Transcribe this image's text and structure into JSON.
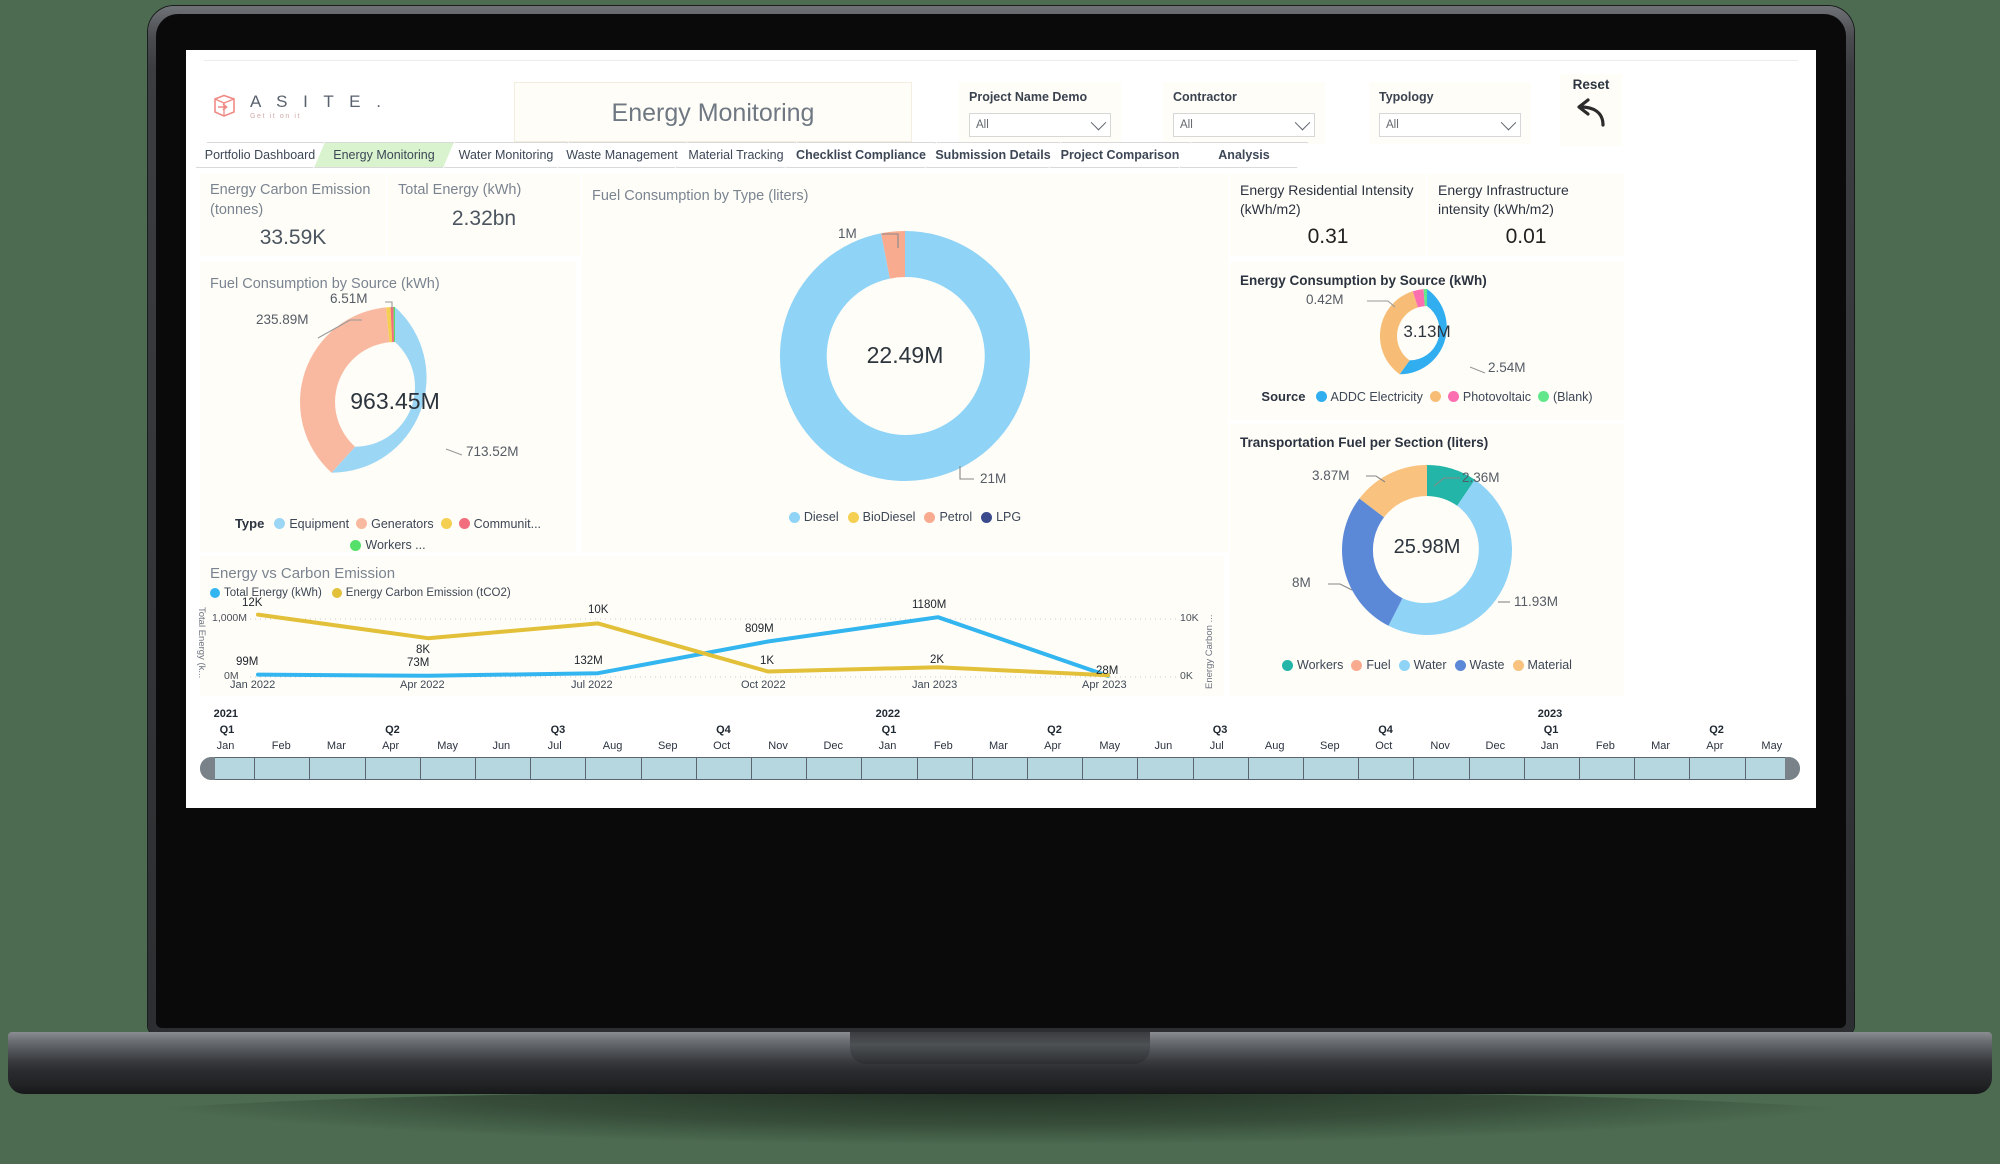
{
  "brand": {
    "name": "A S I T E .",
    "tagline": "Get it on it"
  },
  "header": {
    "title": "Energy Monitoring",
    "reset_label": "Reset",
    "filters": [
      {
        "label": "Project Name Demo",
        "value": "All"
      },
      {
        "label": "Contractor",
        "value": "All"
      },
      {
        "label": "Typology",
        "value": "All"
      }
    ]
  },
  "tabs": [
    {
      "label": "Portfolio Dashboard",
      "active": false,
      "bold": false
    },
    {
      "label": "Energy Monitoring",
      "active": true,
      "bold": false
    },
    {
      "label": "Water Monitoring",
      "active": false,
      "bold": false
    },
    {
      "label": "Waste Management",
      "active": false,
      "bold": false
    },
    {
      "label": "Material Tracking",
      "active": false,
      "bold": false
    },
    {
      "label": "Checklist Compliance",
      "active": false,
      "bold": true
    },
    {
      "label": "Submission Details",
      "active": false,
      "bold": true
    },
    {
      "label": "Project Comparison",
      "active": false,
      "bold": true
    },
    {
      "label": "Analysis",
      "active": false,
      "bold": true
    }
  ],
  "kpis": [
    {
      "title": "Energy Carbon Emission (tonnes)",
      "value": "33.59K"
    },
    {
      "title": "Total Energy (kWh)",
      "value": "2.32bn"
    },
    {
      "title": "Energy Residential Intensity (kWh/m2)",
      "value": "0.31"
    },
    {
      "title": "Energy Infrastructure intensity (kWh/m2)",
      "value": "0.01"
    }
  ],
  "chart_data": [
    {
      "id": "fuel_by_type",
      "type": "pie",
      "title": "Fuel Consumption by Type (liters)",
      "center_label": "22.49M",
      "legend_position": "bottom",
      "categories": [
        "Diesel",
        "BioDiesel",
        "Petrol",
        "LPG"
      ],
      "values": [
        21,
        0,
        1,
        0
      ],
      "value_labels": [
        "21M",
        "",
        "1M",
        ""
      ],
      "colors": [
        "#8fd3f7",
        "#f5cf52",
        "#f9ab8f",
        "#3a4a8c"
      ]
    },
    {
      "id": "fuel_by_source",
      "type": "pie",
      "title": "Fuel Consumption by Source (kWh)",
      "center_label": "963.45M",
      "legend_position": "bottom",
      "legend_head": "Type",
      "categories": [
        "Equipment",
        "Generators",
        "",
        "Communit...",
        "Workers ..."
      ],
      "values": [
        713.52,
        235.89,
        6.51,
        0,
        0
      ],
      "value_labels": [
        "713.52M",
        "235.89M",
        "6.51M",
        "",
        ""
      ],
      "colors": [
        "#9bd6f5",
        "#f9b9a0",
        "#f5cf52",
        "#f26d7d",
        "#55e06a"
      ]
    },
    {
      "id": "energy_by_source",
      "type": "pie",
      "title": "Energy Consumption by Source (kWh)",
      "center_label": "3.13M",
      "legend_position": "bottom",
      "legend_head": "Source",
      "categories": [
        "ADDC Electricity",
        "",
        "Photovoltaic",
        "(Blank)"
      ],
      "values": [
        2.54,
        0.42,
        0.14,
        0.03
      ],
      "value_labels": [
        "2.54M",
        "0.42M",
        "",
        ""
      ],
      "colors": [
        "#31aef0",
        "#f7bd77",
        "#fb6fb1",
        "#62e88a"
      ]
    },
    {
      "id": "transport_fuel",
      "type": "pie",
      "title": "Transportation Fuel per Section (liters)",
      "center_label": "25.98M",
      "legend_position": "bottom",
      "categories": [
        "Workers",
        "Fuel",
        "Water",
        "Waste",
        "Material"
      ],
      "values": [
        2.36,
        0,
        11.93,
        8,
        3.87
      ],
      "value_labels": [
        "2.36M",
        "",
        "11.93M",
        "8M",
        "3.87M"
      ],
      "colors": [
        "#22b5a8",
        "#f9ab8f",
        "#8fd3f7",
        "#5b89d8",
        "#f9c27e"
      ]
    },
    {
      "id": "energy_vs_carbon",
      "type": "line",
      "title": "Energy vs Carbon Emission",
      "xlabel": "",
      "ylabel": "Total Energy (k...",
      "ylabel_right": "Energy Carbon ...",
      "ylim": [
        0,
        1300
      ],
      "ylim_right": [
        0,
        13
      ],
      "yticks": [
        "0M",
        "1,000M"
      ],
      "yticks_right": [
        "0K",
        "10K"
      ],
      "x": [
        "Jan 2022",
        "Apr 2022",
        "Jul 2022",
        "Oct 2022",
        "Jan 2023",
        "Apr 2023"
      ],
      "grid": true,
      "series": [
        {
          "name": "Total Energy (kWh)",
          "color": "#33b5f0",
          "values": [
            99,
            73,
            132,
            809,
            1180,
            28
          ],
          "labels": [
            "99M",
            "73M",
            "132M",
            "809M",
            "1180M",
            "28M"
          ]
        },
        {
          "name": "Energy Carbon Emission (tCO2)",
          "color": "#e2c03a",
          "values": [
            12,
            8,
            10,
            1,
            2,
            0.3
          ],
          "labels": [
            "12K",
            "8K",
            "10K",
            "1K",
            "2K",
            ""
          ]
        }
      ]
    }
  ],
  "timeline": {
    "years": [
      {
        "label": "2021",
        "index": 0
      },
      {
        "label": "2022",
        "index": 12
      },
      {
        "label": "2023",
        "index": 24
      }
    ],
    "quarters": [
      {
        "label": "Q1",
        "index": 0
      },
      {
        "label": "Q2",
        "index": 3
      },
      {
        "label": "Q3",
        "index": 6
      },
      {
        "label": "Q4",
        "index": 9
      },
      {
        "label": "Q1",
        "index": 12
      },
      {
        "label": "Q2",
        "index": 15
      },
      {
        "label": "Q3",
        "index": 18
      },
      {
        "label": "Q4",
        "index": 21
      },
      {
        "label": "Q1",
        "index": 24
      },
      {
        "label": "Q2",
        "index": 27
      }
    ],
    "months": [
      "Jan",
      "Feb",
      "Mar",
      "Apr",
      "May",
      "Jun",
      "Jul",
      "Aug",
      "Sep",
      "Oct",
      "Nov",
      "Dec",
      "Jan",
      "Feb",
      "Mar",
      "Apr",
      "May",
      "Jun",
      "Jul",
      "Aug",
      "Sep",
      "Oct",
      "Nov",
      "Dec",
      "Jan",
      "Feb",
      "Mar",
      "Apr",
      "May"
    ]
  }
}
